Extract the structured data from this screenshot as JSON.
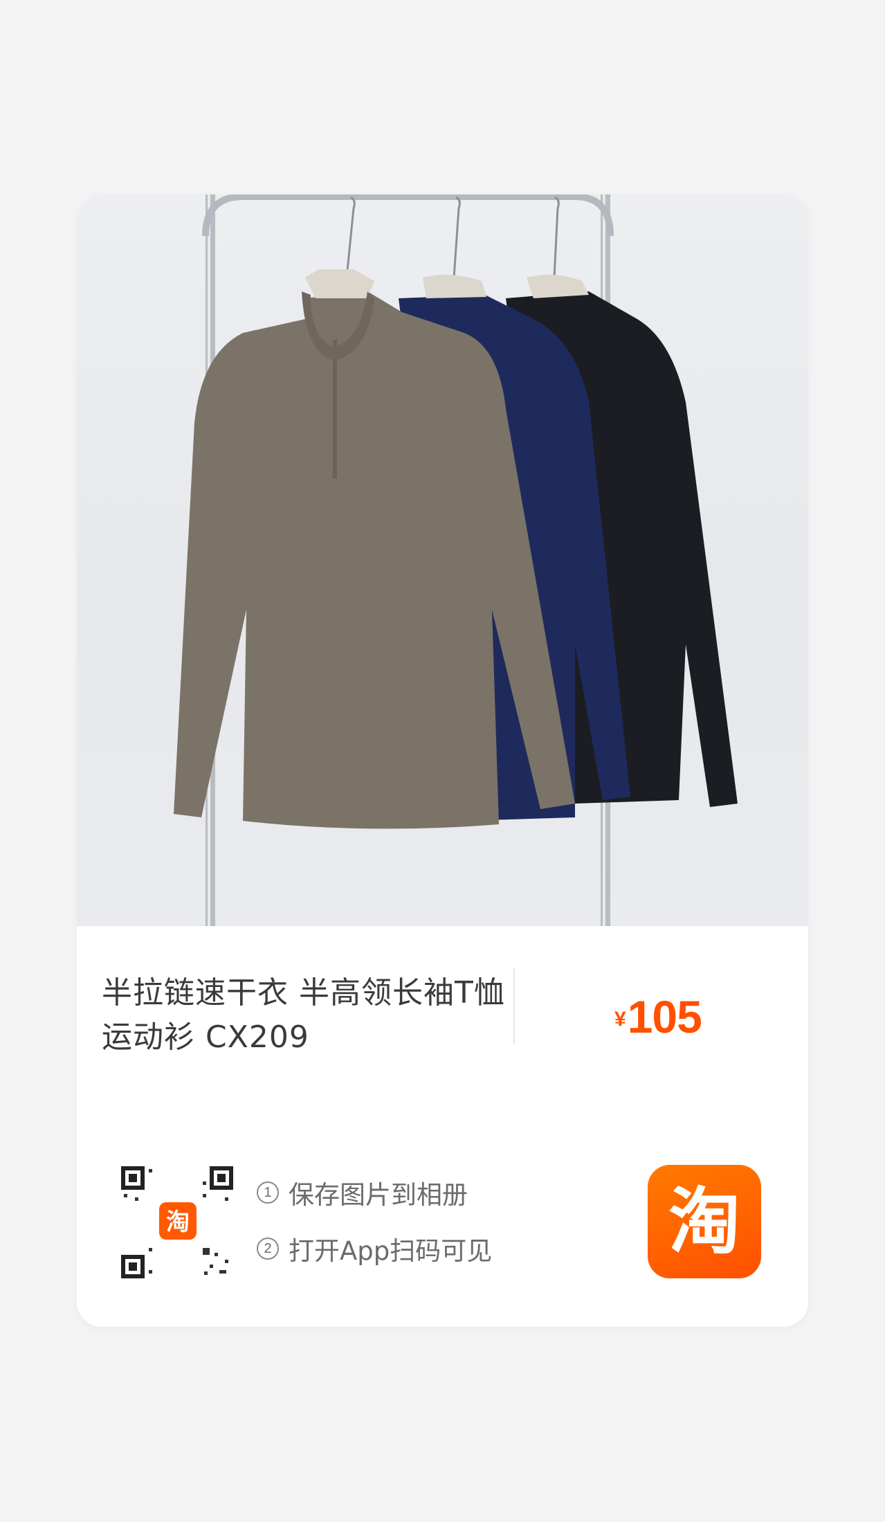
{
  "product": {
    "title": "半拉链速干衣 半高领长袖T恤运动衫 CX209",
    "price_currency": "¥",
    "price_amount": "105"
  },
  "instructions": [
    {
      "num": "1",
      "text": "保存图片到相册"
    },
    {
      "num": "2",
      "text": "打开App扫码可见"
    }
  ],
  "qr": {
    "center_glyph": "淘"
  },
  "logo": {
    "glyph": "淘"
  },
  "colors": {
    "accent": "#ff5000",
    "shirt_brown": "#7b7368",
    "shirt_navy": "#1f2a5c",
    "shirt_black": "#1c1d22"
  }
}
